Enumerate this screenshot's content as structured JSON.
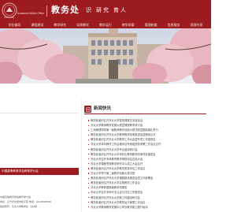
{
  "header": {
    "logo_text": "學",
    "logo_en": "Academic Affairs Office",
    "logo_sub": "University",
    "title": "教务处",
    "motto": "识 研究 育人"
  },
  "nav": {
    "items": [
      {
        "label": "学业辅导"
      },
      {
        "label": "课程建设"
      },
      {
        "label": "教学研究"
      },
      {
        "label": "实践教学"
      },
      {
        "label": "教学运行"
      },
      {
        "label": "教学质量"
      },
      {
        "label": "管理制度"
      },
      {
        "label": "信息服务"
      },
      {
        "label": "资源共享"
      }
    ]
  },
  "left": {
    "bar_text": "中国高等教育学会教育学分会"
  },
  "news": {
    "title": "新闻快讯",
    "items": [
      "教务处组织召开东北大学智慧课程交流座谈会",
      "东北大学教师教学发展大赛暨课堂教学研讨会",
      "工商管理学院第一届教师教学创新大赛决赛暨颁奖典礼举行",
      "教务处组织召开东北大学教育教学改革推进会暨颁奖仪式",
      "教务处组织召开东北大学教育工作大会暨专项工作推进会",
      "东北大学本科教学工作合格评估专家组进校考察工作会议召开",
      "教务处组织召开东北大学专业建设研讨会",
      "教务处组织召开东北大学本科生教育教学改革项目推进会",
      "东北大学召开本科教育教学审核评估总结大会",
      "东北大学课程思政教学研究中心成立大会召开",
      "教务处组织召开东北大学教学质量评估工作会议",
      "东北大学举行第二届教学创新大赛决赛",
      "教务处组织召开东北大学课程建设推进会暨工作部署会",
      "教务处组织召开东北大学实践教学工作会议",
      "东北大学荣获国家级教学成果奖",
      "东北大学召开本科专业认证与评估工作推进会",
      "教务处组织召开东北大学新工科建设研讨会",
      "教务处组织召开东北大学教学运行管理工作会议",
      "东北大学教师教学发展中心举办教学能力提升培训"
    ]
  },
  "footer": {
    "line1": "中国高等教育学会教育学分会",
    "line2": "地址：辽宁省沈阳市和平区 电话：024-83687000",
    "line3": "版权所有：东北大学教务处 【关闭】"
  }
}
